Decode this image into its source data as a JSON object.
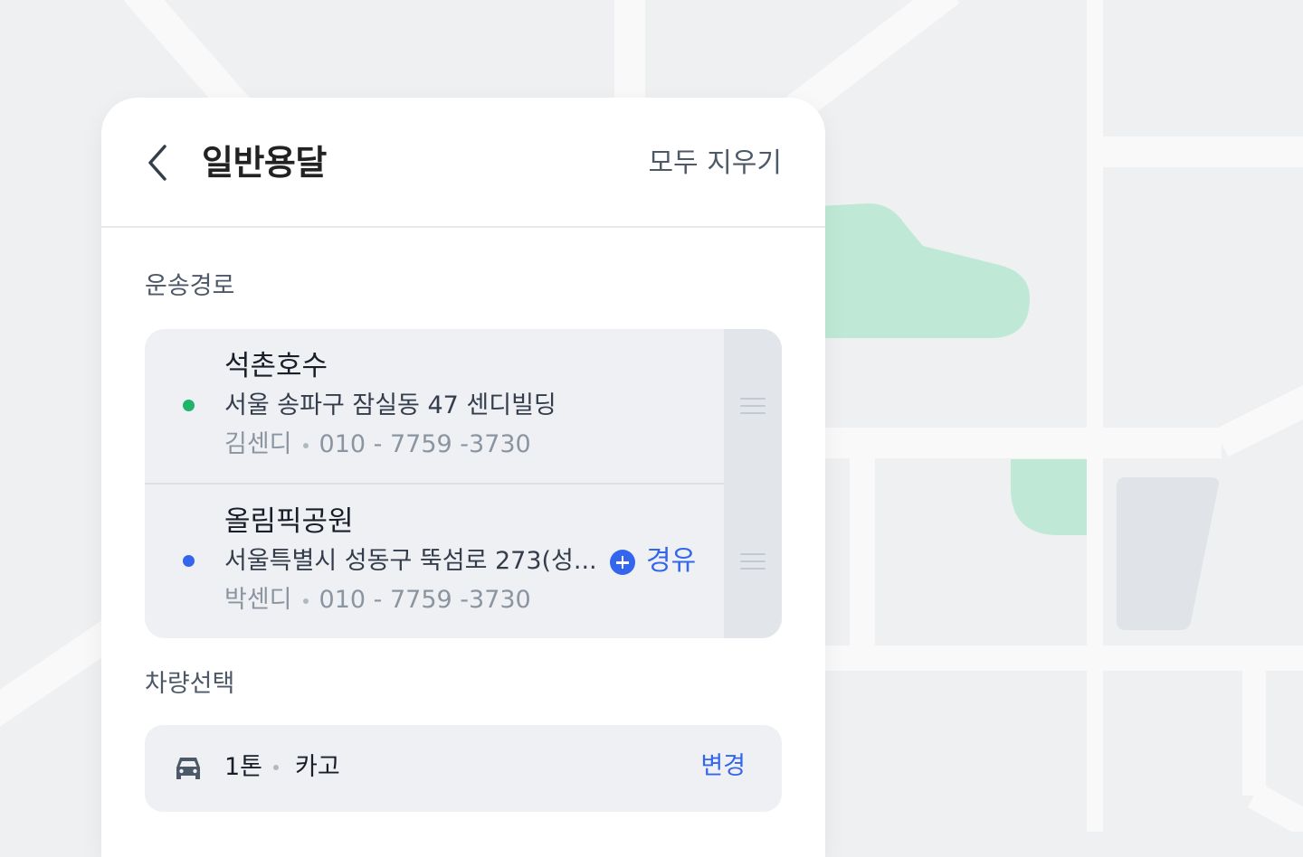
{
  "header": {
    "title": "일반용달",
    "clear_all": "모두 지우기"
  },
  "route_section": {
    "label": "운송경로",
    "stops": [
      {
        "name": "석촌호수",
        "address": "서울 송파구 잠실동 47 센디빌딩",
        "contact_name": "김센디",
        "phone": "010 - 7759 -3730",
        "dot_color": "#1fb46a"
      },
      {
        "name": "올림픽공원",
        "address": "서울특별시 성동구 뚝섬로 273(성...",
        "contact_name": "박센디",
        "phone": "010 - 7759 -3730",
        "dot_color": "#3366ec"
      }
    ],
    "waypoint_label": "경유"
  },
  "vehicle_section": {
    "label": "차량선택",
    "size": "1톤",
    "type": "카고",
    "change_label": "변경"
  },
  "colors": {
    "accent": "#3366ec",
    "map_background": "#eff0f2",
    "map_road": "#f9f9fa",
    "map_park": "#bfe9d6",
    "map_building": "#e0e3e8"
  }
}
